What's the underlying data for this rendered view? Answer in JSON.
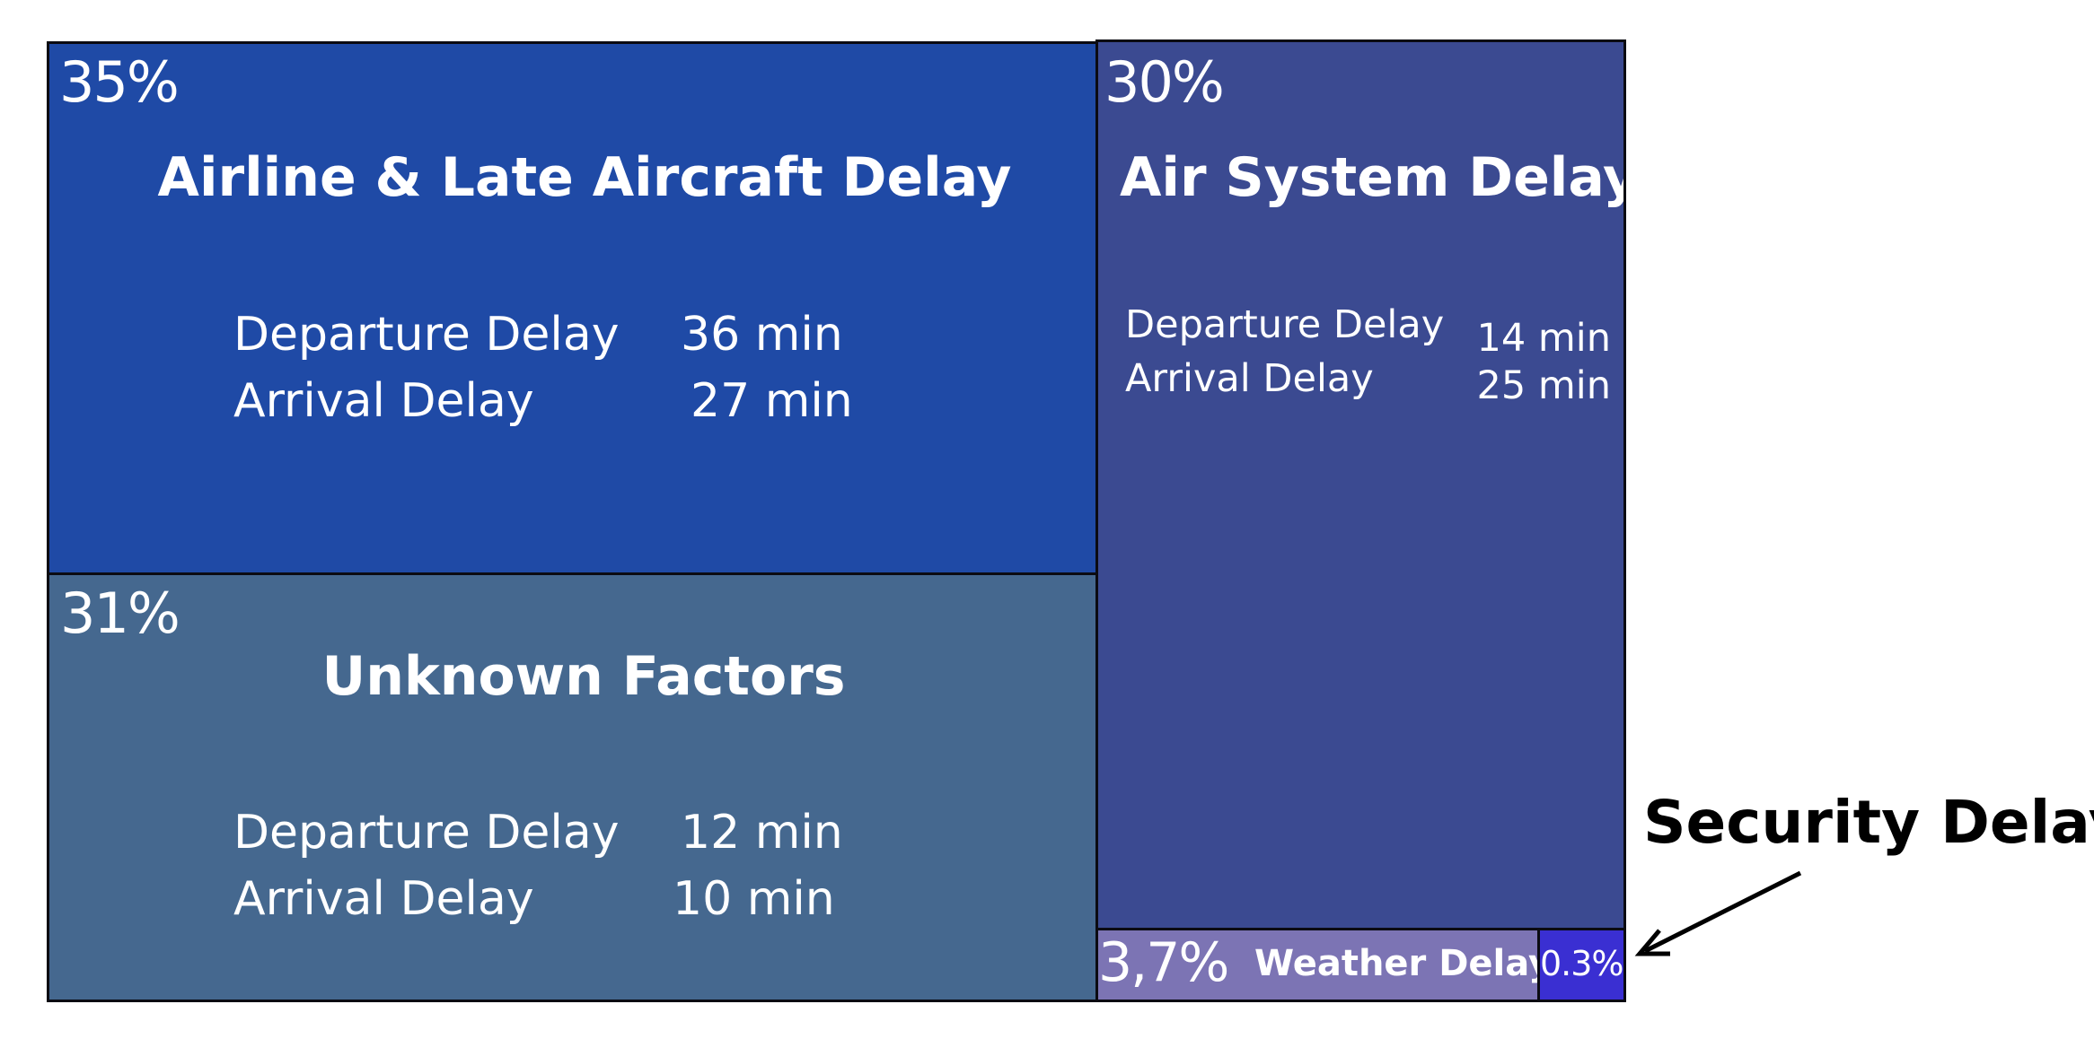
{
  "chart_data": {
    "type": "treemap",
    "tiles": [
      {
        "id": "airline",
        "name": "Airline & Late Aircraft Delay",
        "share_percent": 35,
        "share_label": "35%",
        "color": "#1f4aa6",
        "metrics": [
          {
            "label": "Departure Delay",
            "value": 36,
            "value_label": "36 min"
          },
          {
            "label": "Arrival Delay",
            "value": 27,
            "value_label": "27 min"
          }
        ]
      },
      {
        "id": "unknown",
        "name": "Unknown Factors",
        "share_percent": 31,
        "share_label": "31%",
        "color": "#45688f",
        "metrics": [
          {
            "label": "Departure Delay",
            "value": 12,
            "value_label": "12 min"
          },
          {
            "label": "Arrival Delay",
            "value": 10,
            "value_label": "10 min"
          }
        ]
      },
      {
        "id": "airsystem",
        "name": "Air System Delay",
        "share_percent": 30,
        "share_label": "30%",
        "color": "#3b4a91",
        "metrics": [
          {
            "label": "Departure Delay",
            "value": 14,
            "value_label": "14 min"
          },
          {
            "label": "Arrival Delay",
            "value": 25,
            "value_label": "25 min"
          }
        ]
      },
      {
        "id": "weather",
        "name": "Weather Delay",
        "share_percent": 3.7,
        "share_label": "3,7%",
        "color": "#7c74b4"
      },
      {
        "id": "security",
        "name": "Security Delay",
        "share_percent": 0.3,
        "share_label": "0.3%",
        "color": "#3a2fd2"
      }
    ]
  },
  "annotation": {
    "text": "Security Delay"
  }
}
